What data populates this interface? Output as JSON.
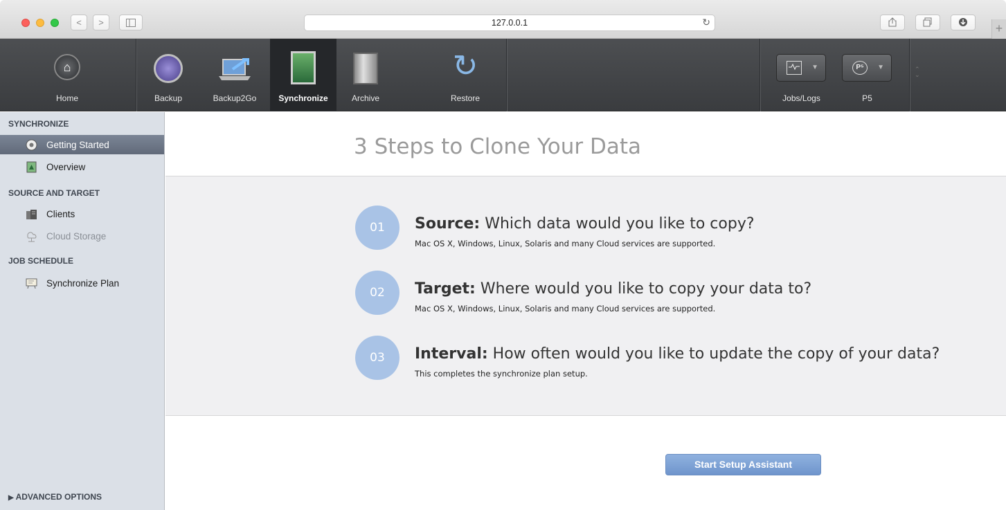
{
  "browser": {
    "url": "127.0.0.1",
    "nav_back": "<",
    "nav_forward": ">",
    "new_tab": "+"
  },
  "toolbar": {
    "tools": [
      {
        "label": "Home"
      },
      {
        "label": "Backup"
      },
      {
        "label": "Backup2Go"
      },
      {
        "label": "Synchronize",
        "active": true
      },
      {
        "label": "Archive"
      },
      {
        "label": "Restore"
      }
    ],
    "right": [
      {
        "label": "Jobs/Logs"
      },
      {
        "label": "P5",
        "badge": "P5"
      }
    ]
  },
  "sidebar": {
    "sections": [
      {
        "title": "SYNCHRONIZE",
        "items": [
          {
            "label": "Getting Started",
            "icon": "help-icon",
            "selected": true
          },
          {
            "label": "Overview",
            "icon": "sync-icon"
          }
        ]
      },
      {
        "title": "SOURCE AND TARGET",
        "items": [
          {
            "label": "Clients",
            "icon": "server-icon"
          },
          {
            "label": "Cloud Storage",
            "icon": "cloud-storage-icon",
            "disabled": true
          }
        ]
      },
      {
        "title": "JOB SCHEDULE",
        "items": [
          {
            "label": "Synchronize Plan",
            "icon": "plan-icon"
          }
        ]
      }
    ],
    "advanced": "ADVANCED OPTIONS"
  },
  "main": {
    "title": "3 Steps to Clone Your Data",
    "steps": [
      {
        "num": "01",
        "head": "Source:",
        "text": "Which data would you like to copy?",
        "sub": "Mac OS X, Windows, Linux, Solaris and many Cloud services are supported."
      },
      {
        "num": "02",
        "head": "Target:",
        "text": "Where would you like to copy your data to?",
        "sub": "Mac OS X, Windows, Linux, Solaris and many Cloud services are supported."
      },
      {
        "num": "03",
        "head": "Interval:",
        "text": "How often would you like to update the copy of your data?",
        "sub": "This completes the synchronize plan setup."
      }
    ],
    "cta": "Start Setup Assistant"
  },
  "colors": {
    "accent": "#a9c3e6",
    "button": "#7ea3d6",
    "toolbar": "#3f4144",
    "sidebar": "#dbe0e7"
  }
}
